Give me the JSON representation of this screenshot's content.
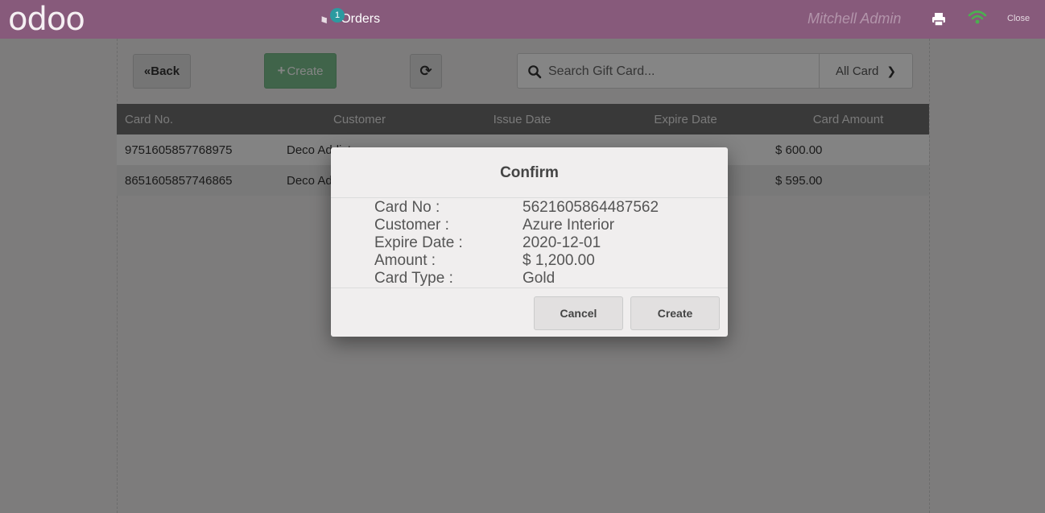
{
  "topbar": {
    "logo": "odoo",
    "orders_label": "Orders",
    "orders_count": "1",
    "user_name": "Mitchell Admin",
    "close_label": "Close"
  },
  "toolbar": {
    "back_label": "Back",
    "create_label": "Create",
    "search_placeholder": "Search Gift Card...",
    "filter_label": "All Card"
  },
  "table": {
    "columns": [
      "Card No.",
      "Customer",
      "Issue Date",
      "Expire Date",
      "Card Amount"
    ],
    "rows": [
      [
        "9751605857768975",
        "Deco Addict",
        "",
        "",
        "$ 600.00"
      ],
      [
        "8651605857746865",
        "Deco Addict",
        "",
        "",
        "$ 595.00"
      ]
    ]
  },
  "modal": {
    "title": "Confirm",
    "fields": [
      {
        "label": "Card No :",
        "value": "5621605864487562"
      },
      {
        "label": "Customer :",
        "value": "Azure Interior"
      },
      {
        "label": "Expire Date :",
        "value": "2020-12-01"
      },
      {
        "label": "Amount :",
        "value": "$ 1,200.00"
      },
      {
        "label": "Card Type :",
        "value": "Gold"
      }
    ],
    "cancel_label": "Cancel",
    "create_label": "Create"
  },
  "colors": {
    "topbar": "#875a7b",
    "create_button": "#7cc08f",
    "table_header": "#6d6d6d",
    "wifi": "#4caf50"
  }
}
